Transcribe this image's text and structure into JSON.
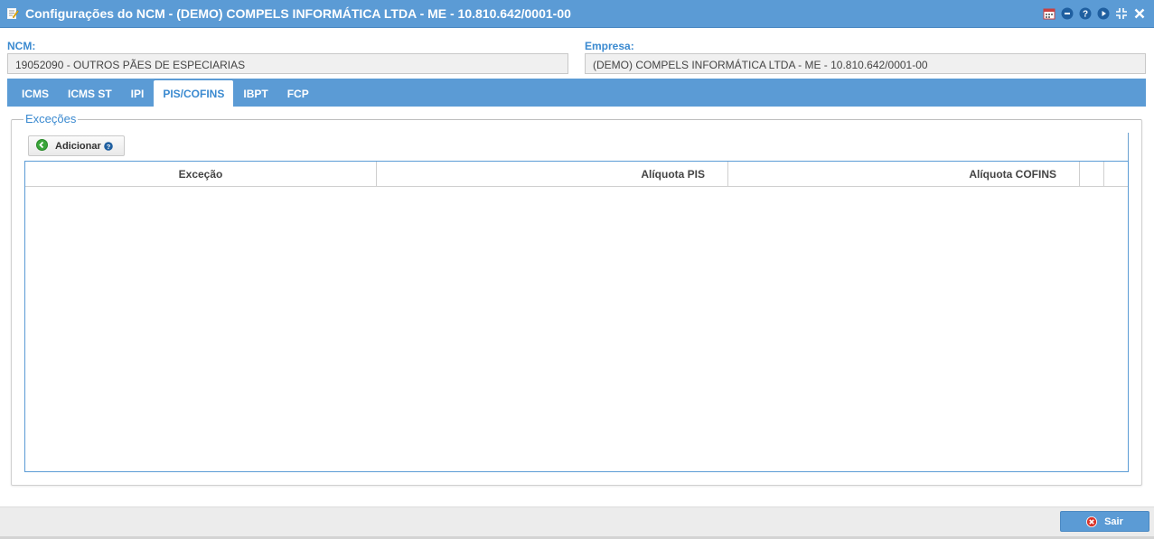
{
  "window": {
    "title": "Configurações do NCM - (DEMO) COMPELS INFORMÁTICA LTDA - ME - 10.810.642/0001-00",
    "title_icon": "edit-document-icon",
    "tools": [
      "calendar-icon",
      "minimize-icon",
      "help-icon",
      "play-icon",
      "restore-icon",
      "close-icon"
    ]
  },
  "form": {
    "ncm_label": "NCM:",
    "ncm_value": "19052090 - OUTROS PÃES DE ESPECIARIAS",
    "empresa_label": "Empresa:",
    "empresa_value": "(DEMO) COMPELS INFORMÁTICA LTDA - ME - 10.810.642/0001-00"
  },
  "tabs": [
    {
      "label": "ICMS",
      "active": false
    },
    {
      "label": "ICMS ST",
      "active": false
    },
    {
      "label": "IPI",
      "active": false
    },
    {
      "label": "PIS/COFINS",
      "active": true
    },
    {
      "label": "IBPT",
      "active": false
    },
    {
      "label": "FCP",
      "active": false
    }
  ],
  "excecoes": {
    "legend": "Exceções",
    "add_button_label": "Adicionar",
    "columns": [
      "Exceção",
      "Alíquota PIS",
      "Alíquota COFINS"
    ],
    "rows": []
  },
  "footer": {
    "exit_label": "Sair"
  },
  "colors": {
    "primary": "#5b9bd5",
    "label_blue": "#3b8ad0",
    "add_green": "#3aa53a",
    "exit_red": "#d9342b"
  }
}
